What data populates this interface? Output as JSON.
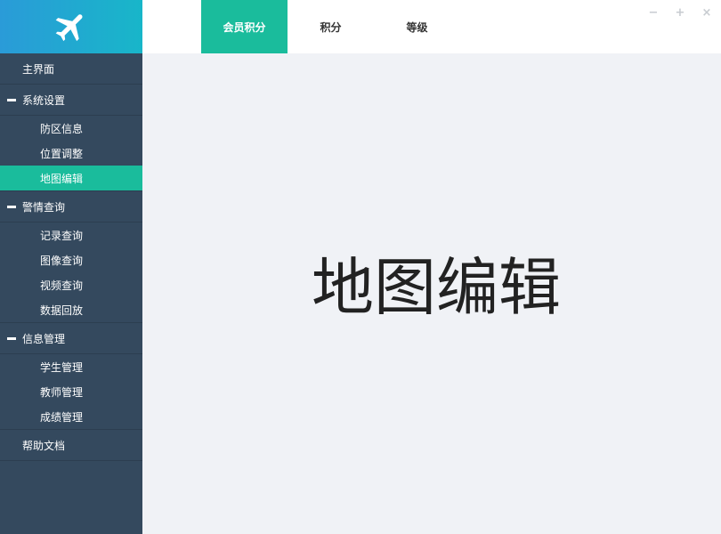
{
  "logo": {
    "icon": "airplane-icon",
    "color": "#ffffff"
  },
  "tabs": [
    {
      "label": "会员积分",
      "active": true
    },
    {
      "label": "积分",
      "active": false
    },
    {
      "label": "等级",
      "active": false
    }
  ],
  "window_controls": {
    "minimize": "−",
    "maximize": "+",
    "close": "×"
  },
  "sidebar": {
    "home": "主界面",
    "groups": [
      {
        "label": "系统设置",
        "items": [
          "防区信息",
          "位置调整",
          "地图编辑"
        ]
      },
      {
        "label": "警情查询",
        "items": [
          "记录查询",
          "图像查询",
          "视频查询",
          "数据回放"
        ]
      },
      {
        "label": "信息管理",
        "items": [
          "学生管理",
          "教师管理",
          "成绩管理"
        ]
      }
    ],
    "help": "帮助文档",
    "active_item": "地图编辑"
  },
  "main": {
    "title": "地图编辑"
  },
  "colors": {
    "accent": "#1abc9c",
    "sidebar_bg": "#34495e",
    "content_bg": "#f0f2f6",
    "logo_gradient_start": "#2a9bd8",
    "logo_gradient_end": "#18b6c9"
  }
}
